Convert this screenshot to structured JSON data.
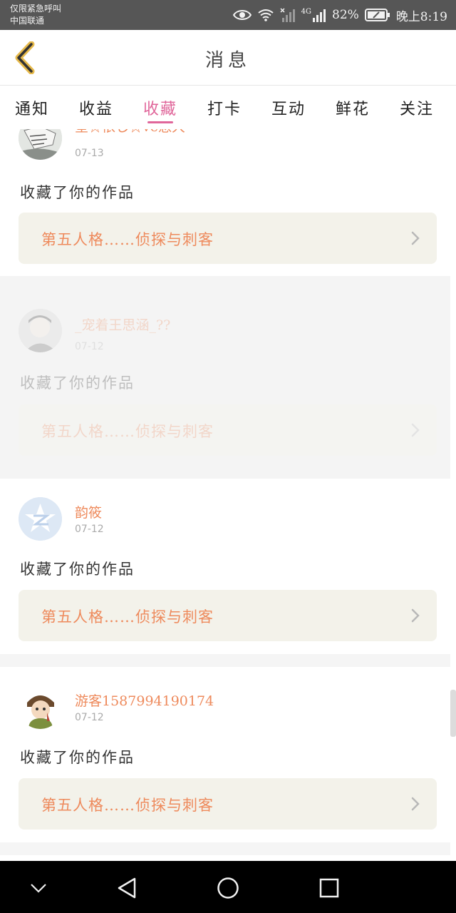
{
  "status_bar": {
    "line1": "仅限紧急呼叫",
    "line2": "中国联通",
    "network": "4G",
    "battery": "82%",
    "time": "晚上8:19"
  },
  "header": {
    "title": "消息",
    "back_icon": "chevron-left-icon"
  },
  "tabs": [
    {
      "label": "通知"
    },
    {
      "label": "收益"
    },
    {
      "label": "收藏",
      "active": true
    },
    {
      "label": "打卡"
    },
    {
      "label": "互动"
    },
    {
      "label": "鲜花"
    },
    {
      "label": "关注"
    }
  ],
  "notifications": [
    {
      "username": "星☆依し☆ve憩大",
      "date": "07-13",
      "action": "收藏了你的作品",
      "work": "第五人格……侦探与刺客"
    },
    {
      "username": "_宠着王思涵_??",
      "date": "07-12",
      "action": "收藏了你的作品",
      "work": "第五人格……侦探与刺客"
    },
    {
      "username": "韵筱",
      "date": "07-12",
      "action": "收藏了你的作品",
      "work": "第五人格……侦探与刺客"
    },
    {
      "username": "游客1587994190174",
      "date": "07-12",
      "action": "收藏了你的作品",
      "work": "第五人格……侦探与刺客"
    }
  ],
  "colors": {
    "accent": "#e0669a",
    "username": "#ee8a5c",
    "link_bg": "#f3f2ea"
  }
}
